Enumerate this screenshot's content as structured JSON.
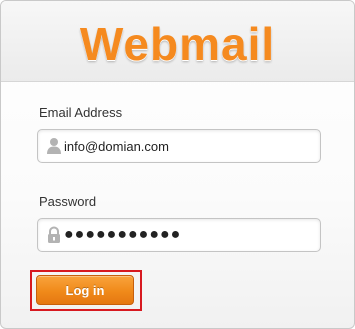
{
  "header": {
    "logo_text": "Webmail"
  },
  "email_field": {
    "label": "Email Address",
    "value": "info@domian.com",
    "icon": "user-icon"
  },
  "password_field": {
    "label": "Password",
    "value": "●●●●●●●●●●●",
    "icon": "lock-icon"
  },
  "login_button": {
    "label": "Log in"
  },
  "colors": {
    "brand_orange": "#f58a1f",
    "button_orange": "#f08a1a",
    "highlight_red": "#d71920"
  }
}
